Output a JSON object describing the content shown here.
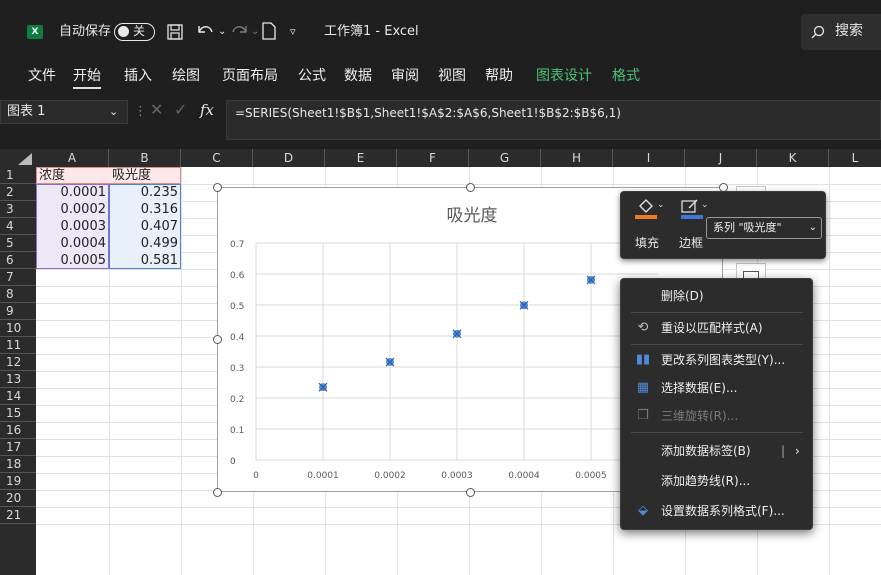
{
  "titlebar": {
    "app_icon": "X",
    "autosave_label": "自动保存",
    "autosave_state": "关",
    "save_icon": "save-icon",
    "undo_icon": "undo-icon",
    "redo_icon": "redo-icon",
    "new_icon": "new-file-icon",
    "customize_icon": "customize-icon",
    "title": "工作簿1 - Excel",
    "search_label": "搜索"
  },
  "ribbon": {
    "tabs": [
      {
        "label": "文件"
      },
      {
        "label": "开始"
      },
      {
        "label": "插入"
      },
      {
        "label": "绘图"
      },
      {
        "label": "页面布局"
      },
      {
        "label": "公式"
      },
      {
        "label": "数据"
      },
      {
        "label": "审阅"
      },
      {
        "label": "视图"
      },
      {
        "label": "帮助"
      },
      {
        "label": "图表设计"
      },
      {
        "label": "格式"
      }
    ],
    "active_tab": "开始"
  },
  "formula_bar": {
    "name_box": "图表 1",
    "fx": "fx",
    "formula": "=SERIES(Sheet1!$B$1,Sheet1!$A$2:$A$6,Sheet1!$B$2:$B$6,1)"
  },
  "columns": [
    "A",
    "B",
    "C",
    "D",
    "E",
    "F",
    "G",
    "H",
    "I",
    "J",
    "K",
    "L"
  ],
  "rows": [
    "1",
    "2",
    "3",
    "4",
    "5",
    "6",
    "7",
    "8",
    "9",
    "10",
    "11",
    "12",
    "13",
    "14",
    "15",
    "16",
    "17",
    "18",
    "19",
    "20",
    "21"
  ],
  "cells": {
    "A1": "浓度",
    "B1": "吸光度",
    "A2": "0.0001",
    "B2": "0.235",
    "A3": "0.0002",
    "B3": "0.316",
    "A4": "0.0003",
    "B4": "0.407",
    "A5": "0.0004",
    "B5": "0.499",
    "A6": "0.0005",
    "B6": "0.581"
  },
  "chart_data": {
    "type": "scatter",
    "title": "吸光度",
    "x": [
      0.0001,
      0.0002,
      0.0003,
      0.0004,
      0.0005
    ],
    "series": [
      {
        "name": "吸光度",
        "values": [
          0.235,
          0.316,
          0.407,
          0.499,
          0.581
        ]
      }
    ],
    "x_ticks": [
      "0",
      "0.0001",
      "0.0002",
      "0.0003",
      "0.0004",
      "0.0005"
    ],
    "y_ticks": [
      "0",
      "0.1",
      "0.2",
      "0.3",
      "0.4",
      "0.5",
      "0.6",
      "0.7"
    ],
    "xlim": [
      0,
      0.0006
    ],
    "ylim": [
      0,
      0.7
    ],
    "grid": true,
    "marker_color": "#4f8bd6"
  },
  "mini_toolbar": {
    "fill_label": "填充",
    "border_label": "边框",
    "series_select": "系列 \"吸光度\"",
    "fill_color": "#f07a1f",
    "border_color": "#3c78d8"
  },
  "context_menu": {
    "items": [
      {
        "label": "删除(D)",
        "icon": "",
        "disabled": false
      },
      {
        "label": "重设以匹配样式(A)",
        "icon": "reset-style-icon",
        "disabled": false
      },
      {
        "label": "更改系列图表类型(Y)...",
        "icon": "change-chart-type-icon",
        "disabled": false
      },
      {
        "label": "选择数据(E)...",
        "icon": "select-data-icon",
        "disabled": false
      },
      {
        "label": "三维旋转(R)...",
        "icon": "3d-rotation-icon",
        "disabled": true
      },
      {
        "label": "添加数据标签(B)",
        "icon": "",
        "disabled": false,
        "submenu": true
      },
      {
        "label": "添加趋势线(R)...",
        "icon": "",
        "disabled": false
      },
      {
        "label": "设置数据系列格式(F)...",
        "icon": "format-series-icon",
        "disabled": false
      }
    ]
  }
}
